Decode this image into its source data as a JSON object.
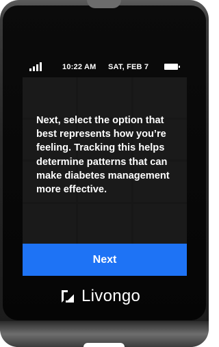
{
  "status": {
    "time": "10:22 AM",
    "date": "SAT, FEB 7",
    "signal_icon": "signal-bars-icon",
    "battery_icon": "battery-full-icon"
  },
  "main": {
    "message": "Next, select the option that best represents how you’re feeling. Tracking this helps determine patterns that can make diabetes management more effective.",
    "next_label": "Next"
  },
  "brand": {
    "name": "Livongo",
    "logo_icon": "livongo-logo-icon"
  },
  "colors": {
    "accent": "#1e73f5",
    "screen_bg": "#2a2a2a",
    "device_body": "#1b1b1b"
  }
}
